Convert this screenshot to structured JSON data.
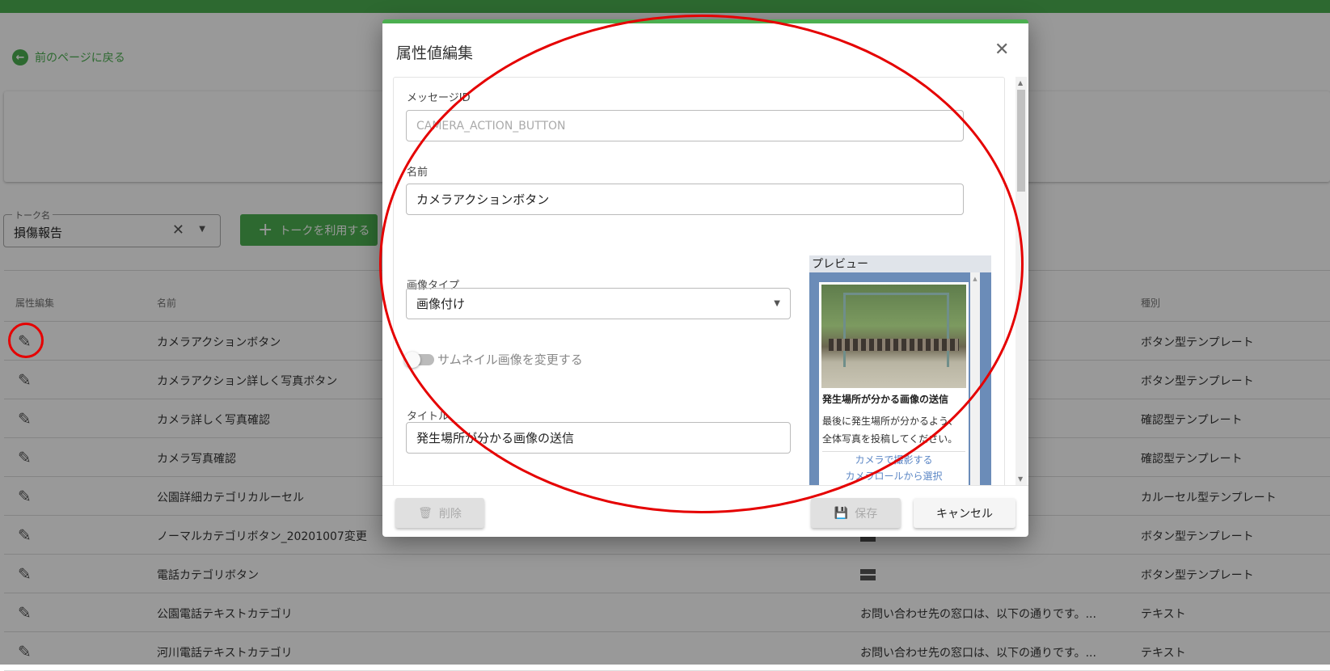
{
  "back_link": "前のページに戻る",
  "talk_select": {
    "label": "トーク名",
    "value": "損傷報告"
  },
  "use_talk_button": "トークを利用する",
  "table": {
    "headers": {
      "edit": "属性編集",
      "name": "名前",
      "kind": "種別"
    },
    "rows": [
      {
        "name": "カメラアクションボタン",
        "content": "",
        "kind": "ボタン型テンプレート"
      },
      {
        "name": "カメラアクション詳しく写真ボタン",
        "content": "",
        "kind": "ボタン型テンプレート"
      },
      {
        "name": "カメラ詳しく写真確認",
        "content": "",
        "kind": "確認型テンプレート"
      },
      {
        "name": "カメラ写真確認",
        "content": "",
        "kind": "確認型テンプレート"
      },
      {
        "name": "公園詳細カテゴリカルーセル",
        "content": "",
        "kind": "カルーセル型テンプレート"
      },
      {
        "name": "ノーマルカテゴリボタン_20201007変更",
        "content": "",
        "kind": "ボタン型テンプレート"
      },
      {
        "name": "電話カテゴリボタン",
        "content": "",
        "kind": "ボタン型テンプレート"
      },
      {
        "name": "公園電話テキストカテゴリ",
        "content": "お問い合わせ先の窓口は、以下の通りです。...",
        "kind": "テキスト"
      },
      {
        "name": "河川電話テキストカテゴリ",
        "content": "お問い合わせ先の窓口は、以下の通りです。...",
        "kind": "テキスト"
      }
    ]
  },
  "modal": {
    "title": "属性値編集",
    "message_id_label": "メッセージID",
    "message_id_value": "CAMERA_ACTION_BUTTON",
    "name_label": "名前",
    "name_value": "カメラアクションボタン",
    "image_type_label": "画像タイプ",
    "image_type_value": "画像付け",
    "thumbnail_toggle_label": "サムネイル画像を変更する",
    "thumbnail_toggle_on": false,
    "title_label": "タイトル",
    "title_value": "発生場所が分かる画像の送信",
    "preview": {
      "header": "プレビュー",
      "title": "発生場所が分かる画像の送信",
      "text_line1": "最後に発生場所が分かるよう、",
      "text_line2": "全体写真を投稿してください。",
      "actions": [
        "カメラで撮影する",
        "カメラロールから選択"
      ]
    },
    "delete_button": "削除",
    "save_button": "保存",
    "cancel_button": "キャンセル"
  },
  "colors": {
    "brand": "#4caf50",
    "annotation": "#e50000",
    "preview_frame": "#6b8cb8"
  }
}
